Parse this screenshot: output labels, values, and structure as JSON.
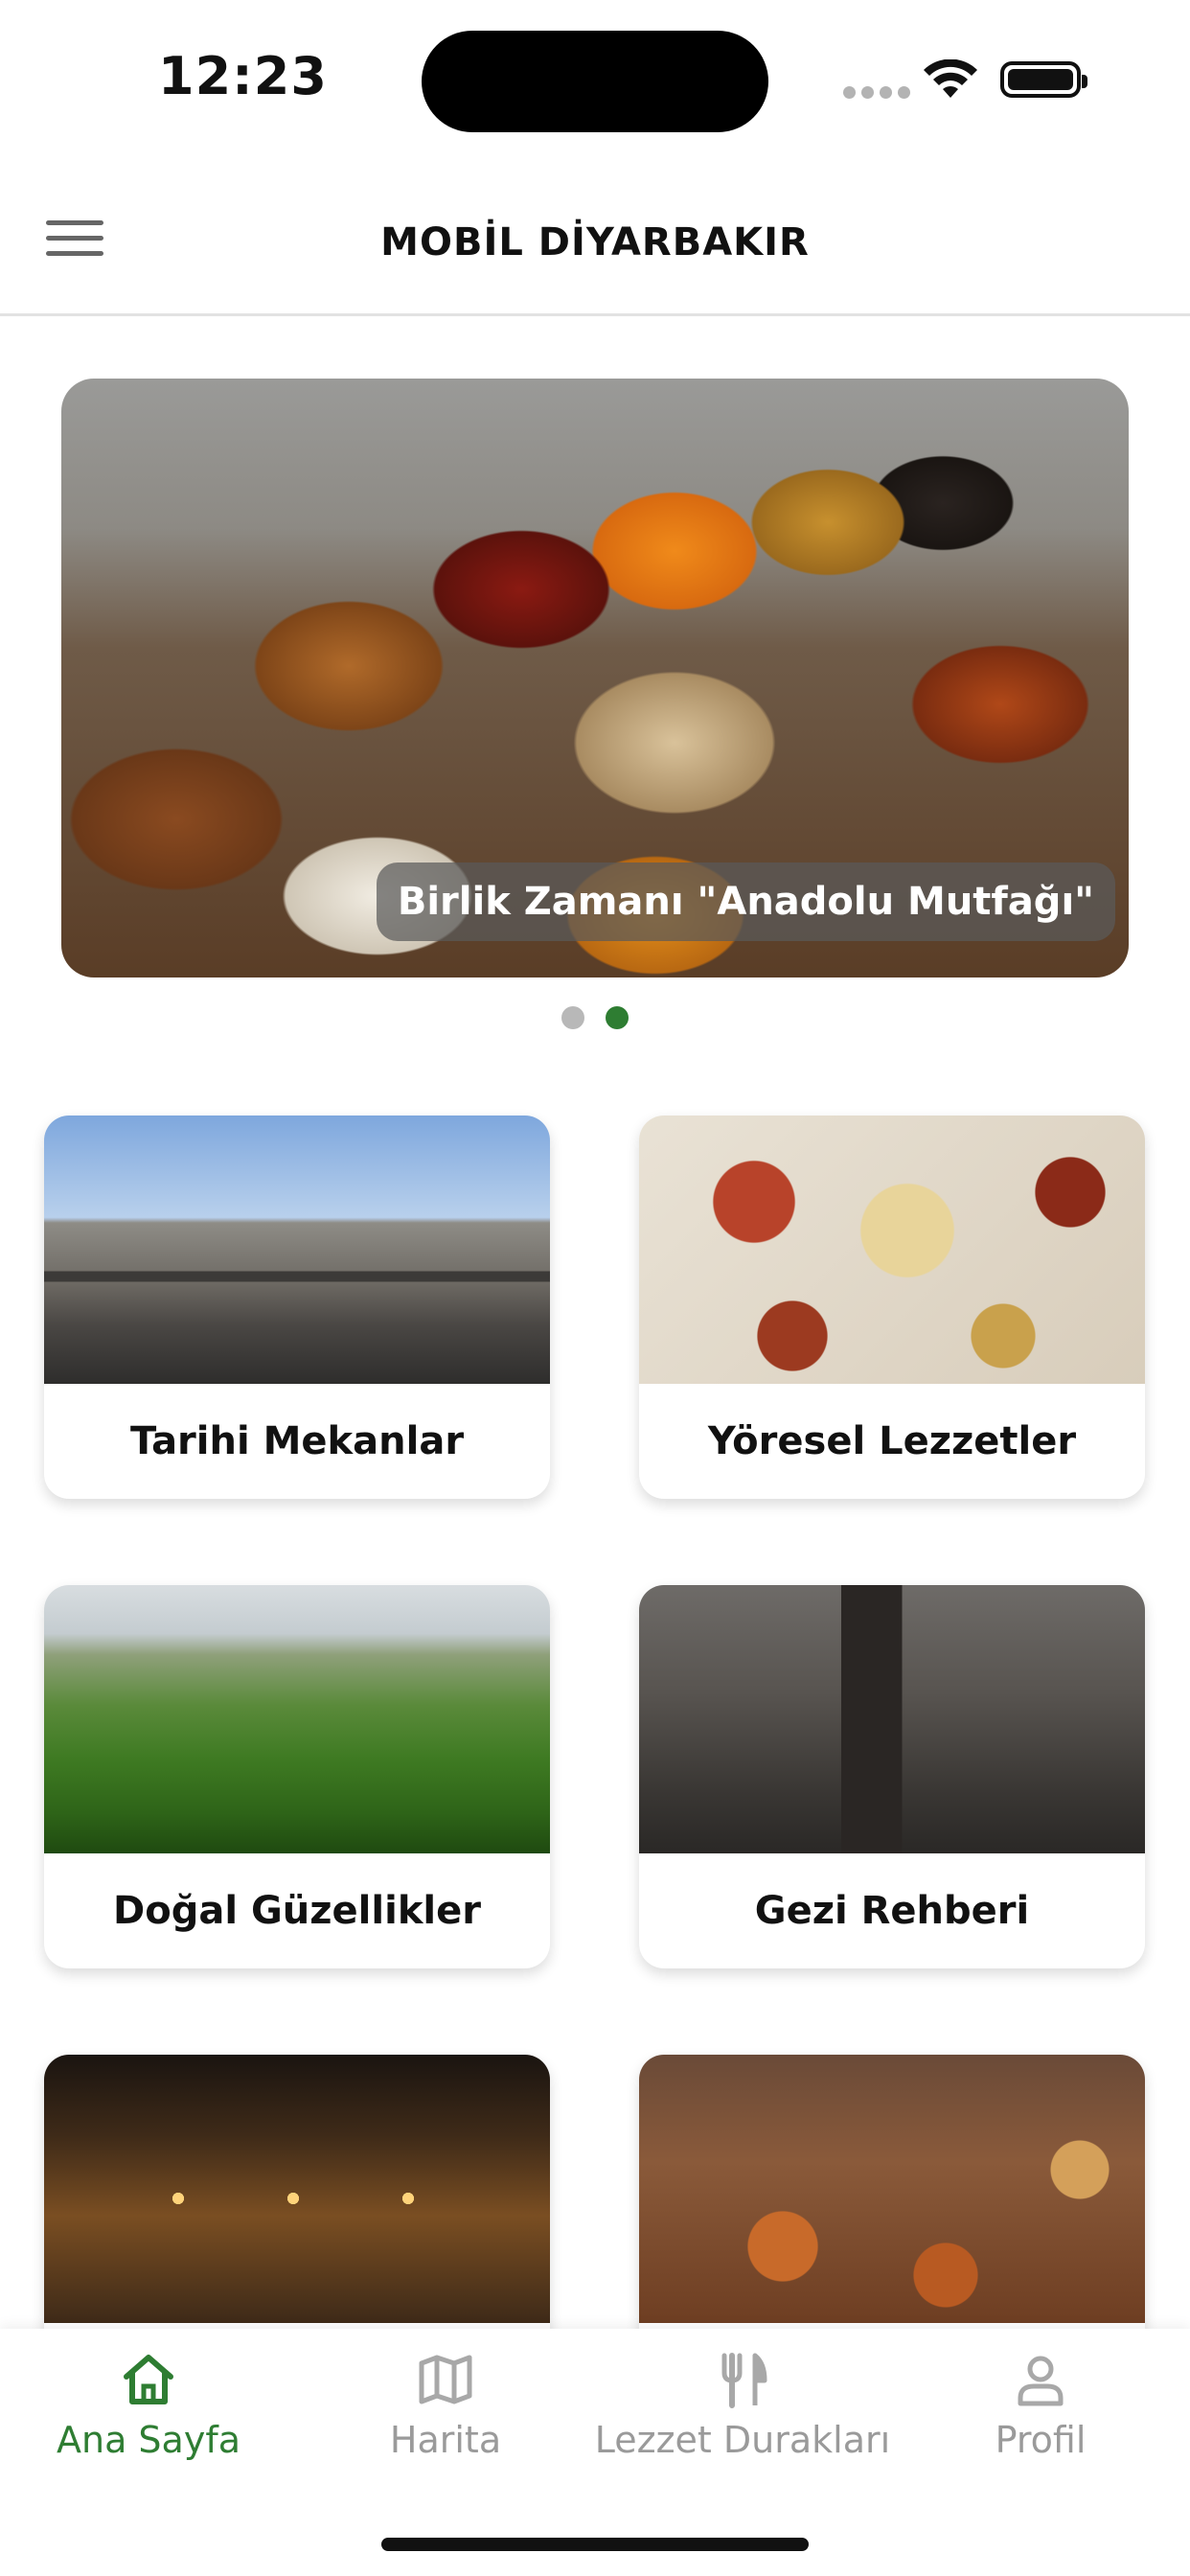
{
  "status_bar": {
    "time": "12:23"
  },
  "header": {
    "title": "MOBİL DİYARBAKIR"
  },
  "carousel": {
    "slide_caption": "Birlik Zamanı \"Anadolu Mutfağı\"",
    "slide_count": 2,
    "active_index": 1
  },
  "categories": [
    {
      "label": "Tarihi Mekanlar"
    },
    {
      "label": "Yöresel Lezzetler"
    },
    {
      "label": "Doğal Güzellikler"
    },
    {
      "label": "Gezi Rehberi"
    }
  ],
  "tab_bar": {
    "active_color": "#2e7d32",
    "inactive_color": "#9a9a9a",
    "tabs": [
      {
        "label": "Ana Sayfa",
        "icon": "home-icon",
        "active": true
      },
      {
        "label": "Harita",
        "icon": "map-icon",
        "active": false
      },
      {
        "label": "Lezzet Durakları",
        "icon": "fork-knife-icon",
        "active": false
      },
      {
        "label": "Profil",
        "icon": "person-icon",
        "active": false
      }
    ]
  }
}
